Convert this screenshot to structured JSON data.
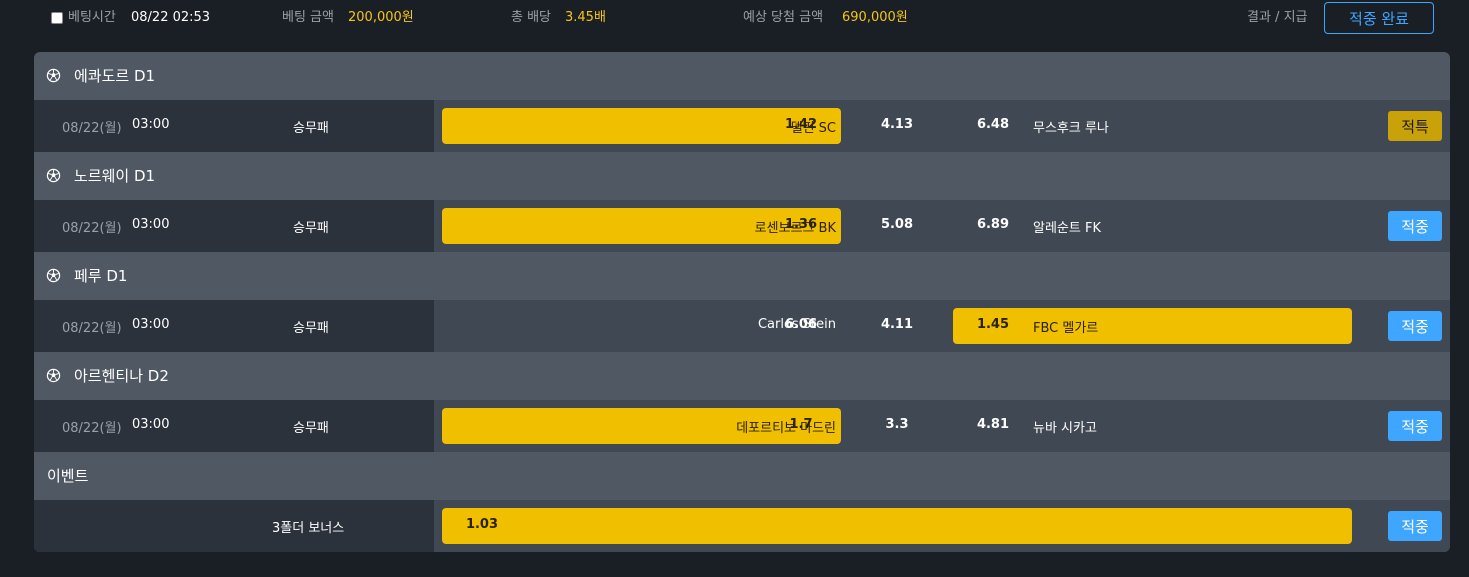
{
  "topbar": {
    "bet_time_label": "베팅시간",
    "bet_time_value": "08/22 02:53",
    "bet_amount_label": "베팅 금액",
    "bet_amount_value": "200,000원",
    "total_odds_label": "총 배당",
    "total_odds_value": "3.45배",
    "expected_label": "예상 당첨 금액",
    "expected_value": "690,000원",
    "result_label": "결과 / 지급",
    "done_button": "적중 완료"
  },
  "colors": {
    "selected": "#f0bf00",
    "hit": "#3ea6ff",
    "special": "#c9a20a"
  },
  "icons": {
    "league": "soccer-ball-icon"
  },
  "bets": [
    {
      "league": "에콰도르 D1",
      "date": "08/22(월)",
      "time": "03:00",
      "type": "승무패",
      "home": "델핀 SC",
      "home_odd": "1.42",
      "draw_odd": "4.13",
      "away_odd": "6.48",
      "away": "무스후크 루나",
      "selected": "home",
      "status": "적특"
    },
    {
      "league": "노르웨이 D1",
      "date": "08/22(월)",
      "time": "03:00",
      "type": "승무패",
      "home": "로센보르그 BK",
      "home_odd": "1.36",
      "draw_odd": "5.08",
      "away_odd": "6.89",
      "away": "알레순트 FK",
      "selected": "home",
      "status": "적중"
    },
    {
      "league": "페루 D1",
      "date": "08/22(월)",
      "time": "03:00",
      "type": "승무패",
      "home": "Carlos Stein",
      "home_odd": "6.06",
      "draw_odd": "4.11",
      "away_odd": "1.45",
      "away": "FBC 멜가르",
      "selected": "away",
      "status": "적중"
    },
    {
      "league": "아르헨티나 D2",
      "date": "08/22(월)",
      "time": "03:00",
      "type": "승무패",
      "home": "데포르티보 마드린",
      "home_odd": "1.7",
      "draw_odd": "3.3",
      "away_odd": "4.81",
      "away": "뉴바 시카고",
      "selected": "home",
      "status": "적중"
    }
  ],
  "event": {
    "title": "이벤트",
    "name": "3폴더 보너스",
    "odd": "1.03",
    "status": "적중"
  }
}
